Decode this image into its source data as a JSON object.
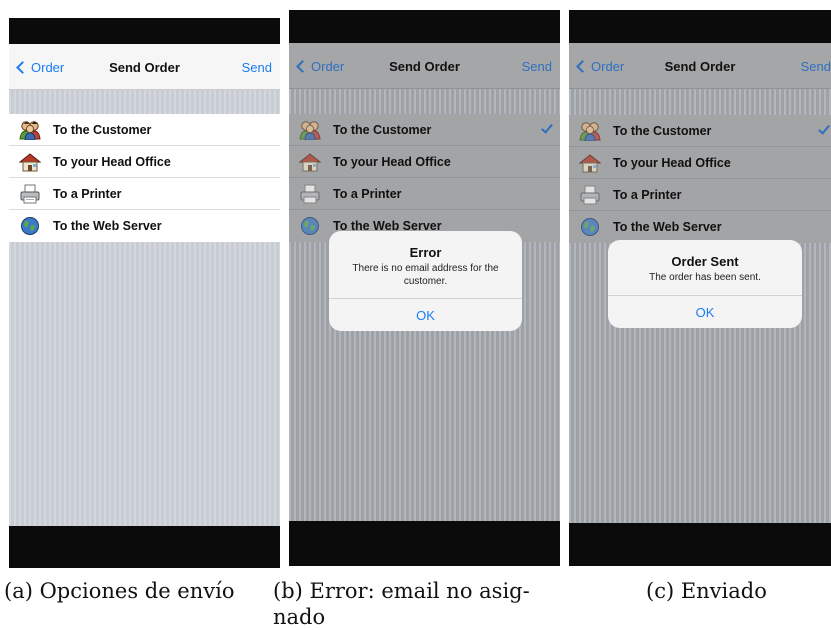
{
  "nav": {
    "back_label": "Order",
    "title": "Send Order",
    "action_label": "Send"
  },
  "options": [
    {
      "label": "To the Customer",
      "icon": "customers-icon"
    },
    {
      "label": "To your Head Office",
      "icon": "house-icon"
    },
    {
      "label": "To a Printer",
      "icon": "printer-icon"
    },
    {
      "label": "To the Web Server",
      "icon": "globe-icon"
    }
  ],
  "alerts": {
    "error": {
      "title": "Error",
      "message": "There is no email address for the customer.",
      "button": "OK"
    },
    "sent": {
      "title": "Order Sent",
      "message": "The order has been sent.",
      "button": "OK"
    }
  },
  "captions": {
    "a": "(a) Opciones de envío",
    "b_line1": "(b) Error: email no asig-",
    "b_line2": "nado",
    "c": "(c) Enviado"
  },
  "colors": {
    "accent": "#1a7cf5",
    "screen_bg": "#c8ccd3",
    "bezel": "#0b0b0b"
  }
}
